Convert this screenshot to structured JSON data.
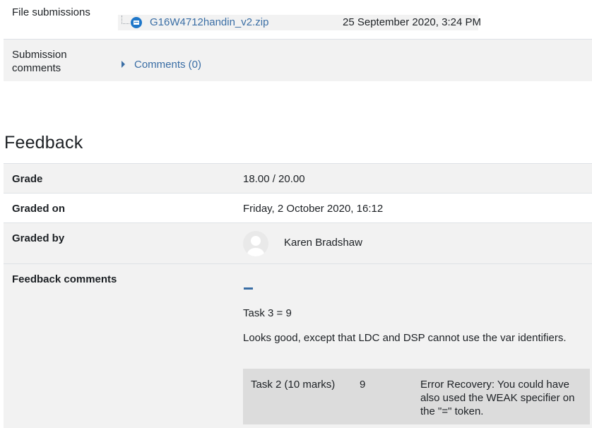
{
  "submission": {
    "file_label": "File submissions",
    "file_name": "G16W4712handin_v2.zip",
    "file_date": "25 September 2020, 3:24 PM",
    "comments_label_line1": "Submission",
    "comments_label_line2": "comments",
    "comments_link": "Comments (0)"
  },
  "feedback": {
    "heading": "Feedback",
    "grade_label": "Grade",
    "grade_value": "18.00 / 20.00",
    "graded_on_label": "Graded on",
    "graded_on_value": "Friday, 2 October 2020, 16:12",
    "graded_by_label": "Graded by",
    "graded_by_value": "Karen Bradshaw",
    "comments_label": "Feedback comments",
    "task_line": "Task 3 = 9",
    "comment_text": "Looks good, except that LDC and DSP cannot use the var identifiers.",
    "table": {
      "task": "Task 2 (10 marks)",
      "mark": "9",
      "note_line1": "Error Recovery: You could have",
      "note_line2": "also used the WEAK specifier on",
      "note_line3": "the \"=\" token."
    }
  },
  "colors": {
    "link": "#3a6ea5",
    "row_grey": "#f2f2f2",
    "table_grey": "#dcdcdc"
  },
  "icons": [
    "file-archive-icon",
    "caret-right-icon",
    "avatar-icon",
    "collapse-icon"
  ]
}
